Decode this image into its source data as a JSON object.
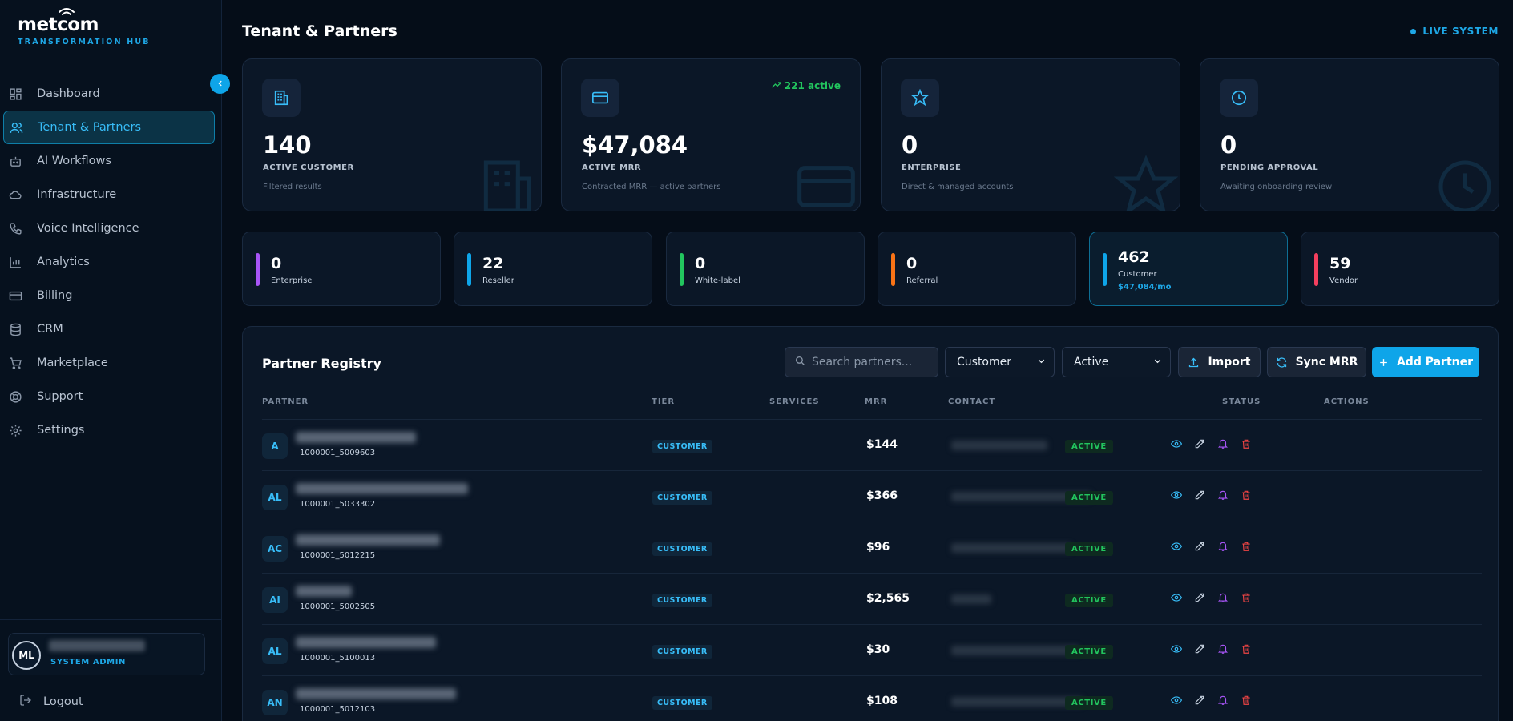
{
  "app": {
    "logo_name": "metcom",
    "logo_sub": "TRANSFORMATION HUB",
    "page_title": "Tenant & Partners",
    "live_label": "LIVE SYSTEM"
  },
  "sidebar": {
    "items": [
      {
        "label": "Dashboard",
        "icon": "dashboard-icon",
        "active": false
      },
      {
        "label": "Tenant & Partners",
        "icon": "users-icon",
        "active": true
      },
      {
        "label": "AI Workflows",
        "icon": "bot-icon",
        "active": false
      },
      {
        "label": "Infrastructure",
        "icon": "cloud-icon",
        "active": false
      },
      {
        "label": "Voice Intelligence",
        "icon": "phone-icon",
        "active": false
      },
      {
        "label": "Analytics",
        "icon": "chart-icon",
        "active": false
      },
      {
        "label": "Billing",
        "icon": "card-icon",
        "active": false
      },
      {
        "label": "CRM",
        "icon": "database-icon",
        "active": false
      },
      {
        "label": "Marketplace",
        "icon": "cart-icon",
        "active": false
      },
      {
        "label": "Support",
        "icon": "lifebuoy-icon",
        "active": false
      },
      {
        "label": "Settings",
        "icon": "gear-icon",
        "active": false
      }
    ],
    "user": {
      "initials": "ML",
      "role": "SYSTEM ADMIN"
    },
    "logout_label": "Logout"
  },
  "stats": [
    {
      "value": "140",
      "label": "ACTIVE CUSTOMER",
      "sub": "Filtered results",
      "icon": "building-icon"
    },
    {
      "value": "$47,084",
      "label": "ACTIVE MRR",
      "sub": "Contracted MRR — active partners",
      "icon": "card-icon",
      "trend": "221 active"
    },
    {
      "value": "0",
      "label": "ENTERPRISE",
      "sub": "Direct & managed accounts",
      "icon": "star-icon"
    },
    {
      "value": "0",
      "label": "PENDING APPROVAL",
      "sub": "Awaiting onboarding review",
      "icon": "clock-icon"
    }
  ],
  "tiers": [
    {
      "value": "0",
      "label": "Enterprise",
      "color": "#a855f7"
    },
    {
      "value": "22",
      "label": "Reseller",
      "color": "#0ea5e9"
    },
    {
      "value": "0",
      "label": "White-label",
      "color": "#22c55e"
    },
    {
      "value": "0",
      "label": "Referral",
      "color": "#f97316"
    },
    {
      "value": "462",
      "label": "Customer",
      "color": "#0ea5e9",
      "sub": "$47,084/mo",
      "selected": true
    },
    {
      "value": "59",
      "label": "Vendor",
      "color": "#f43f5e"
    }
  ],
  "registry": {
    "title": "Partner Registry",
    "search_placeholder": "Search partners...",
    "tier_filter": "Customer",
    "status_filter": "Active",
    "import_label": "Import",
    "sync_label": "Sync MRR",
    "add_label": "Add Partner",
    "columns": [
      "PARTNER",
      "TIER",
      "SERVICES",
      "MRR",
      "CONTACT",
      "STATUS",
      "ACTIONS"
    ],
    "rows": [
      {
        "initials": "A",
        "id": "1000001_5009603",
        "tier": "CUSTOMER",
        "mrr": "$144",
        "status": "ACTIVE"
      },
      {
        "initials": "AL",
        "id": "1000001_5033302",
        "tier": "CUSTOMER",
        "mrr": "$366",
        "status": "ACTIVE"
      },
      {
        "initials": "AC",
        "id": "1000001_5012215",
        "tier": "CUSTOMER",
        "mrr": "$96",
        "status": "ACTIVE"
      },
      {
        "initials": "AI",
        "id": "1000001_5002505",
        "tier": "CUSTOMER",
        "mrr": "$2,565",
        "status": "ACTIVE"
      },
      {
        "initials": "AL",
        "id": "1000001_5100013",
        "tier": "CUSTOMER",
        "mrr": "$30",
        "status": "ACTIVE"
      },
      {
        "initials": "AN",
        "id": "1000001_5012103",
        "tier": "CUSTOMER",
        "mrr": "$108",
        "status": "ACTIVE"
      }
    ]
  },
  "colors": {
    "accent": "#0ea5e9",
    "active_green": "#22c55e",
    "background": "#050d18"
  }
}
